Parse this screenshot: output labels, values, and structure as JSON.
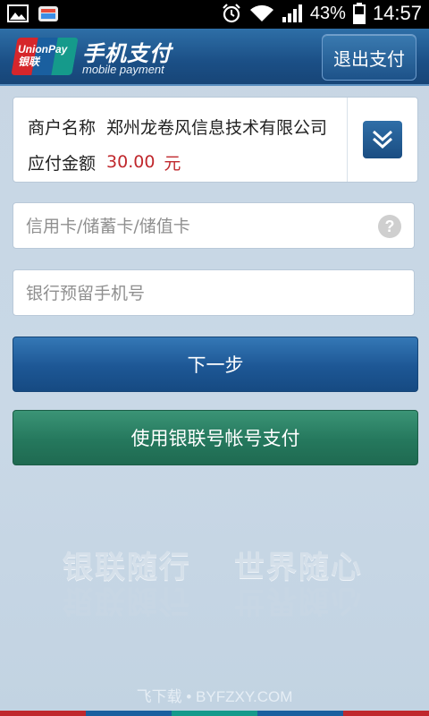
{
  "status_bar": {
    "battery_percent": "43%",
    "time": "14:57",
    "icons": [
      "image-icon",
      "app-icon",
      "alarm-icon",
      "wifi-icon",
      "signal-icon",
      "battery-icon"
    ]
  },
  "header": {
    "logo_text_line1": "UnionPay",
    "logo_text_line2": "银联",
    "title": "手机支付",
    "subtitle": "mobile payment",
    "exit_label": "退出支付"
  },
  "merchant": {
    "name_label": "商户名称",
    "name_value": "郑州龙卷风信息技术有限公司",
    "amount_label": "应付金额",
    "amount_value": "30.00",
    "amount_unit": "元"
  },
  "card_field": {
    "value": "",
    "placeholder": "信用卡/储蓄卡/储值卡",
    "help_symbol": "?"
  },
  "phone_field": {
    "value": "",
    "placeholder": "银行预留手机号"
  },
  "buttons": {
    "next_label": "下一步",
    "unionpay_account_label": "使用银联号帐号支付"
  },
  "slogan": {
    "left": "银联随行",
    "right": "世界随心"
  },
  "watermark": "飞下载 • BYFZXY.COM",
  "colors": {
    "header_blue": "#1b4f86",
    "primary_button": "#1d5795",
    "secondary_button": "#25785d",
    "amount_red": "#c0282d",
    "background": "#c7d6e4"
  }
}
